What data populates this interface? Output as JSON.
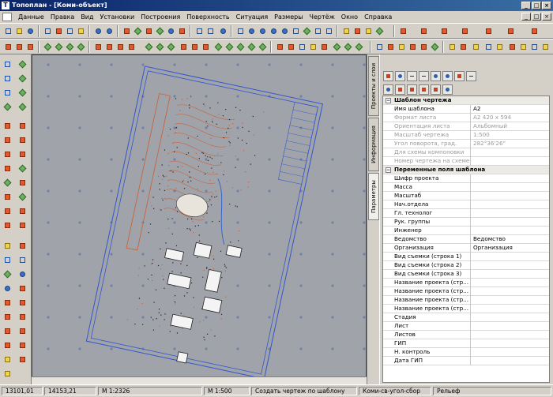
{
  "window": {
    "title": "Топоплан - [Коми-объект]"
  },
  "menu": [
    "Данные",
    "Правка",
    "Вид",
    "Установки",
    "Построения",
    "Поверхность",
    "Ситуация",
    "Размеры",
    "Чертёж",
    "Окно",
    "Справка"
  ],
  "vertical_tabs": {
    "projects": "Проекты и слои",
    "info": "Информация",
    "params": "Параметры"
  },
  "properties": {
    "section1": "Шаблон чертежа",
    "template_rows": [
      {
        "k": "Имя шаблона",
        "v": "А2"
      },
      {
        "k": "Формат листа",
        "v": "А2 420 x 594"
      },
      {
        "k": "Ориентация листа",
        "v": "Альбомный"
      },
      {
        "k": "Масштаб чертежа",
        "v": "1:500"
      },
      {
        "k": "Угол поворота, град.",
        "v": "282°36'26\""
      },
      {
        "k": "Для схемы компоновки",
        "v": ""
      },
      {
        "k": "Номер чертежа на схеме",
        "v": ""
      }
    ],
    "section2": "Переменные поля шаблона",
    "field_rows": [
      {
        "k": "Шифр проекта",
        "v": ""
      },
      {
        "k": "Масса",
        "v": ""
      },
      {
        "k": "Масштаб",
        "v": ""
      },
      {
        "k": "Нач.отдела",
        "v": ""
      },
      {
        "k": "Гл. технолог",
        "v": ""
      },
      {
        "k": "Рук. группы",
        "v": ""
      },
      {
        "k": "Инженер",
        "v": ""
      },
      {
        "k": "Ведомство",
        "v": "Ведомство"
      },
      {
        "k": "Организация",
        "v": "Организация"
      },
      {
        "k": "Вид съемки (строка 1)",
        "v": ""
      },
      {
        "k": "Вид съемки (строка 2)",
        "v": ""
      },
      {
        "k": "Вид съемки (строка 3)",
        "v": ""
      },
      {
        "k": "Название проекта (стр...",
        "v": ""
      },
      {
        "k": "Название проекта (стр...",
        "v": ""
      },
      {
        "k": "Название проекта (стр...",
        "v": ""
      },
      {
        "k": "Название проекта (стр...",
        "v": ""
      },
      {
        "k": "Стадия",
        "v": ""
      },
      {
        "k": "Лист",
        "v": ""
      },
      {
        "k": "Листов",
        "v": ""
      },
      {
        "k": "ГИП",
        "v": ""
      },
      {
        "k": "Н. контроль",
        "v": ""
      },
      {
        "k": "Дата ГИП",
        "v": ""
      }
    ]
  },
  "status": {
    "x": "13101,01",
    "y": "14153,21",
    "scale1": "М 1:2326",
    "scale2": "М 1:500",
    "hint": "Создать чертеж по шаблону",
    "layer": "Коми-св-угол-сбор",
    "mode": "Рельеф"
  },
  "colors": {
    "canvas": "#a0a4aa",
    "frame": "#3355cc",
    "topo": "#c8643c",
    "titlebar": "#0a246a"
  }
}
